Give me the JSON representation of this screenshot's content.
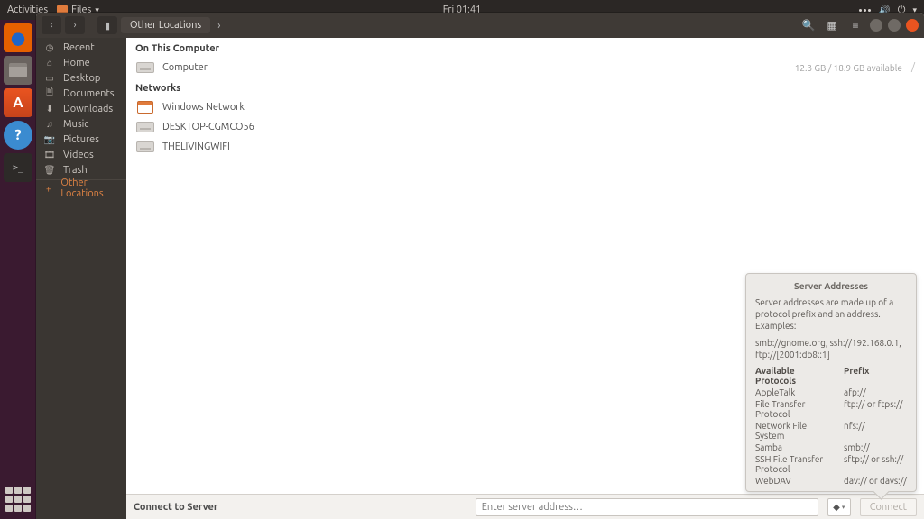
{
  "topbar": {
    "activities": "Activities",
    "app_menu": "Files",
    "clock": "Fri 01:41"
  },
  "titlebar": {
    "location": "Other Locations"
  },
  "sidebar": {
    "items": [
      {
        "icon": "clock",
        "label": "Recent"
      },
      {
        "icon": "home",
        "label": "Home"
      },
      {
        "icon": "desktop",
        "label": "Desktop"
      },
      {
        "icon": "folder",
        "label": "Documents"
      },
      {
        "icon": "download",
        "label": "Downloads"
      },
      {
        "icon": "music",
        "label": "Music"
      },
      {
        "icon": "camera",
        "label": "Pictures"
      },
      {
        "icon": "video",
        "label": "Videos"
      },
      {
        "icon": "trash",
        "label": "Trash"
      },
      {
        "icon": "plus",
        "label": "Other Locations"
      }
    ]
  },
  "sections": {
    "computer_hdr": "On This Computer",
    "networks_hdr": "Networks"
  },
  "computer": {
    "label": "Computer",
    "meta": "12.3 GB / 18.9 GB available",
    "path": "/"
  },
  "networks": [
    {
      "label": "Windows Network",
      "icon": "net"
    },
    {
      "label": "DESKTOP-CGMCO56",
      "icon": "drive"
    },
    {
      "label": "THELIVINGWIFI",
      "icon": "drive"
    }
  ],
  "popover": {
    "title": "Server Addresses",
    "desc": "Server addresses are made up of a protocol prefix and an address. Examples:",
    "examples": "smb://gnome.org, ssh://192.168.0.1, ftp://[2001:db8::1]",
    "col_proto": "Available Protocols",
    "col_prefix": "Prefix",
    "rows": [
      {
        "proto": "AppleTalk",
        "prefix": "afp://"
      },
      {
        "proto": "File Transfer Protocol",
        "prefix": "ftp:// or ftps://"
      },
      {
        "proto": "Network File System",
        "prefix": "nfs://"
      },
      {
        "proto": "Samba",
        "prefix": "smb://"
      },
      {
        "proto": "SSH File Transfer Protocol",
        "prefix": "sftp:// or ssh://"
      },
      {
        "proto": "WebDAV",
        "prefix": "dav:// or davs://"
      }
    ]
  },
  "connect": {
    "label": "Connect to Server",
    "placeholder": "Enter server address…",
    "button": "Connect"
  }
}
